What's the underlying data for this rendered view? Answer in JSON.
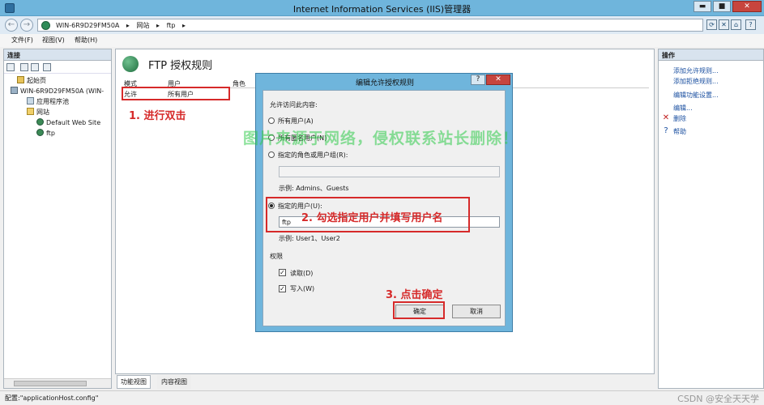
{
  "window": {
    "title": "Internet Information Services (IIS)管理器",
    "controls": {
      "minimize": "▬",
      "maximize": "■",
      "close": "✕"
    }
  },
  "address": {
    "back": "←",
    "forward": "→",
    "crumbs": [
      "WIN-6R9D29FM50A",
      "▸",
      "网站",
      "▸",
      "ftp",
      "▸"
    ]
  },
  "menu": [
    "文件(F)",
    "视图(V)",
    "帮助(H)"
  ],
  "connections": {
    "header": "连接",
    "tree": [
      "起始页",
      "WIN-6R9D29FM50A (WIN-",
      "应用程序池",
      "网站",
      "Default Web Site",
      "ftp"
    ]
  },
  "main": {
    "title": "FTP 授权规则",
    "columns": [
      "模式",
      "用户",
      "角色"
    ],
    "row": {
      "mode": "允许",
      "user": "所有用户"
    },
    "tabs": [
      "功能视图",
      "内容视图"
    ]
  },
  "actions": {
    "header": "操作",
    "items": [
      "添加允许规则...",
      "添加拒绝规则...",
      "编辑功能设置...",
      "编辑...",
      "删除",
      "帮助"
    ]
  },
  "dialog": {
    "title": "编辑允许授权规则",
    "help_btn": "?",
    "close_btn": "✕",
    "prompt": "允许访问此内容:",
    "opt_all": "所有用户(A)",
    "opt_anon": "所有匿名用户(N)",
    "opt_roles": "指定的角色或用户组(R):",
    "roles_example": "示例: Admins、Guests",
    "opt_users": "指定的用户(U):",
    "users_value": "ftp",
    "users_example": "示例: User1、User2",
    "perm_label": "权限",
    "perm_read": "读取(D)",
    "perm_write": "写入(W)",
    "ok": "确定",
    "cancel": "取消"
  },
  "annotations": {
    "step1": "1. 进行双击",
    "step2": "2. 勾选指定用户并填写用户名",
    "step3": "3. 点击确定",
    "watermark": "图片来源于网络，侵权联系站长删除！"
  },
  "status": {
    "text": "配置:\"applicationHost.config\"",
    "credit": "CSDN @安全天天学"
  },
  "colors": {
    "annotation": "#d62a2a",
    "watermark": "#2fcb4a",
    "titlebar": "#6fb5dc",
    "link": "#1a4fa0"
  }
}
